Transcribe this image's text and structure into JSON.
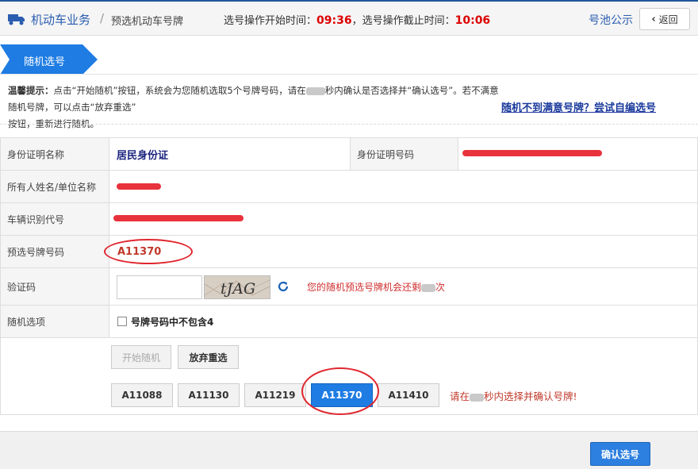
{
  "header": {
    "module": "机动车业务",
    "separator": "/",
    "page": "预选机动车号牌",
    "start_label": "选号操作开始时间：",
    "start_time": "09:36",
    "end_label": "，选号操作截止时间：",
    "end_time": "10:06",
    "pool_link": "号池公示",
    "back_label": "返回"
  },
  "section_tab": "随机选号",
  "tip": {
    "title": "温馨提示：",
    "part1": "点击“开始随机”按钮，系统会为您随机选取5个号牌号码，请在",
    "part2": "秒内确认是否选择并“确认选号”。若不满意随机号牌，可以点击“放弃重选”",
    "part3": "按钮，重新进行随机。",
    "self_select_link": "随机不到满意号牌？尝试自编选号"
  },
  "form": {
    "id_type_label": "身份证明名称",
    "id_type_value": "居民身份证",
    "id_number_label": "身份证明号码",
    "owner_label": "所有人姓名/单位名称",
    "vin_label": "车辆识别代号",
    "plate_label": "预选号牌号码",
    "plate_value": "A11370",
    "captcha_label": "验证码",
    "captcha_text": "tJAG",
    "remain_part1": "您的随机预选号牌机会还剩",
    "remain_part2": "次",
    "options_label": "随机选项",
    "exclude4_label": "号牌号码中不包含4"
  },
  "actions": {
    "start_random": "开始随机",
    "abandon": "放弃重选",
    "confirm_msg_part1": "请在",
    "confirm_msg_part2": "秒内选择并确认号牌!",
    "confirm_button": "确认选号"
  },
  "plates": [
    "A11088",
    "A11130",
    "A11219",
    "A11370",
    "A11410"
  ],
  "selected_plate": "A11370",
  "colors": {
    "accent": "#1e7ce3",
    "time": "#dd0000",
    "highlight_ring": "#e0262e"
  }
}
